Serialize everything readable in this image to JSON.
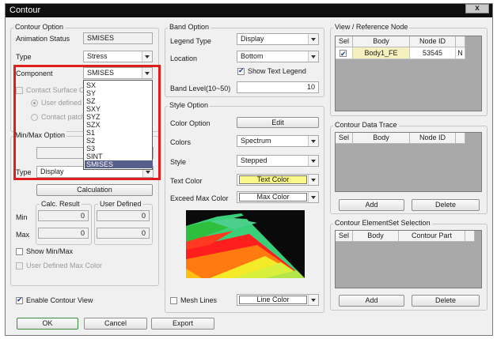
{
  "window": {
    "title": "Contour",
    "close": "x"
  },
  "contour_option": {
    "title": "Contour Option",
    "animation_status_label": "Animation Status",
    "animation_status_value": "SMISES",
    "type_label": "Type",
    "type_value": "Stress",
    "component_label": "Component",
    "component_value": "SMISES",
    "contact_surface_label": "Contact Surface O",
    "user_defined_label": "User defined",
    "contact_patch_label": "Contact patch"
  },
  "component_dropdown": {
    "items": [
      "SX",
      "SY",
      "SZ",
      "SXY",
      "SYZ",
      "SZX",
      "S1",
      "S2",
      "S3",
      "SINT",
      "SMISES"
    ],
    "selected": "SMISES"
  },
  "minmax_option": {
    "title": "Min/Max Option",
    "type_label": "Type",
    "type_value": "Display",
    "calculation_button": "Calculation",
    "calc_result_title": "Calc. Result",
    "user_defined_title": "User Defined",
    "min_label": "Min",
    "max_label": "Max",
    "calc_min": "0",
    "calc_max": "0",
    "user_min": "0",
    "user_max": "0",
    "show_minmax_label": "Show Min/Max",
    "user_defined_max_color_label": "User Defined Max Color"
  },
  "enable_contour_label": "Enable Contour View",
  "band_option": {
    "title": "Band Option",
    "legend_type_label": "Legend Type",
    "legend_type_value": "Display",
    "location_label": "Location",
    "location_value": "Bottom",
    "show_text_legend_label": "Show Text Legend",
    "band_level_label": "Band Level(10~50)",
    "band_level_value": "10"
  },
  "style_option": {
    "title": "Style Option",
    "color_option_label": "Color Option",
    "edit_button": "Edit",
    "colors_label": "Colors",
    "colors_value": "Spectrum",
    "style_label": "Style",
    "style_value": "Stepped",
    "text_color_label": "Text Color",
    "text_color_value": "Text Color",
    "exceed_max_color_label": "Exceed Max Color",
    "max_color_value": "Max Color",
    "mesh_lines_label": "Mesh Lines",
    "line_color_value": "Line Color",
    "text_color_swatch": "#fbf88a"
  },
  "view_reference": {
    "title": "View / Reference Node",
    "columns": [
      "Sel",
      "Body",
      "Node ID"
    ],
    "rows": [
      {
        "body": "Body1_FE",
        "node_id": "53545",
        "extra": "N"
      }
    ]
  },
  "data_trace": {
    "title": "Contour Data Trace",
    "columns": [
      "Sel",
      "Body",
      "Node ID"
    ],
    "add_button": "Add",
    "delete_button": "Delete"
  },
  "elementset": {
    "title": "Contour ElementSet Selection",
    "columns": [
      "Sel",
      "Body",
      "Contour Part"
    ],
    "add_button": "Add",
    "delete_button": "Delete"
  },
  "footer": {
    "ok": "OK",
    "cancel": "Cancel",
    "export": "Export"
  }
}
